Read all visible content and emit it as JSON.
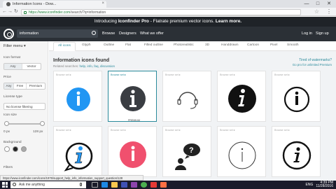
{
  "browser": {
    "tab_title": "Information Icons - Dow...",
    "tab_close": "×",
    "win_minimize": "—",
    "win_maximize": "□",
    "win_close": "✕",
    "back": "←",
    "forward": "→",
    "reload": "↻",
    "url_host": "https://www.iconfinder.com",
    "url_path": "/search/?q=information",
    "star": "☆",
    "menu": "⋮"
  },
  "promo": {
    "prefix": "Introducing ",
    "brand": "Iconfinder Pro",
    "rest": " - Flatrate premium vector icons. ",
    "cta": "Learn more."
  },
  "header": {
    "search_value": "information",
    "nav": [
      "Browse",
      "Designers",
      "What we offer"
    ],
    "login": "Log in",
    "signup": "Sign up"
  },
  "sidebar": {
    "filter_toggle": "Filter menu ▾",
    "icon_format_label": "Icon format",
    "icon_format_options": [
      "Any",
      "Vector"
    ],
    "price_label": "Price",
    "price_options": [
      "Any",
      "Free",
      "Premium"
    ],
    "license_label": "License type",
    "license_value": "No license filtering",
    "size_label": "Icon size",
    "size_min": "0 px",
    "size_max": "128 px",
    "bg_label": "Background",
    "filters_label": "Filters"
  },
  "main": {
    "tabs": [
      "All icons",
      "Glyph",
      "Outline",
      "Flat",
      "Filled outline",
      "Photorealistic",
      "3D",
      "Handdrawn",
      "Cartoon",
      "Pixel",
      "Smooth"
    ],
    "results_title": "Information icons found",
    "related_prefix": "Related searches: ",
    "related_terms": "help, info, faq, discussion",
    "watermark_q": "Tired of watermarks?",
    "watermark_sub": "Go pro for unlimited Premium",
    "card_labels": [
      "Browse set ▸",
      "Browse set ▸",
      "Browse set ▸",
      "Browse set ▸",
      "Browse set ▸",
      "Browse set ▸",
      "Browse set ▸",
      "Browse set ▸",
      "Browse set ▸",
      "Browse set ▸"
    ],
    "premium_tag": "PREMIUM"
  },
  "status": {
    "url": "https://www.iconfinder.com/icons/1976/support_help_info_information_support_question/128"
  },
  "taskbar": {
    "search_placeholder": "Ask me anything",
    "time": "4:39 PM",
    "date": "11/28/2016",
    "lang": "ENG"
  },
  "colors": {
    "accent": "#2a8a9b",
    "blue_icon": "#2196f3",
    "pink_icon": "#f0506e",
    "dark_header": "#2b3036"
  }
}
